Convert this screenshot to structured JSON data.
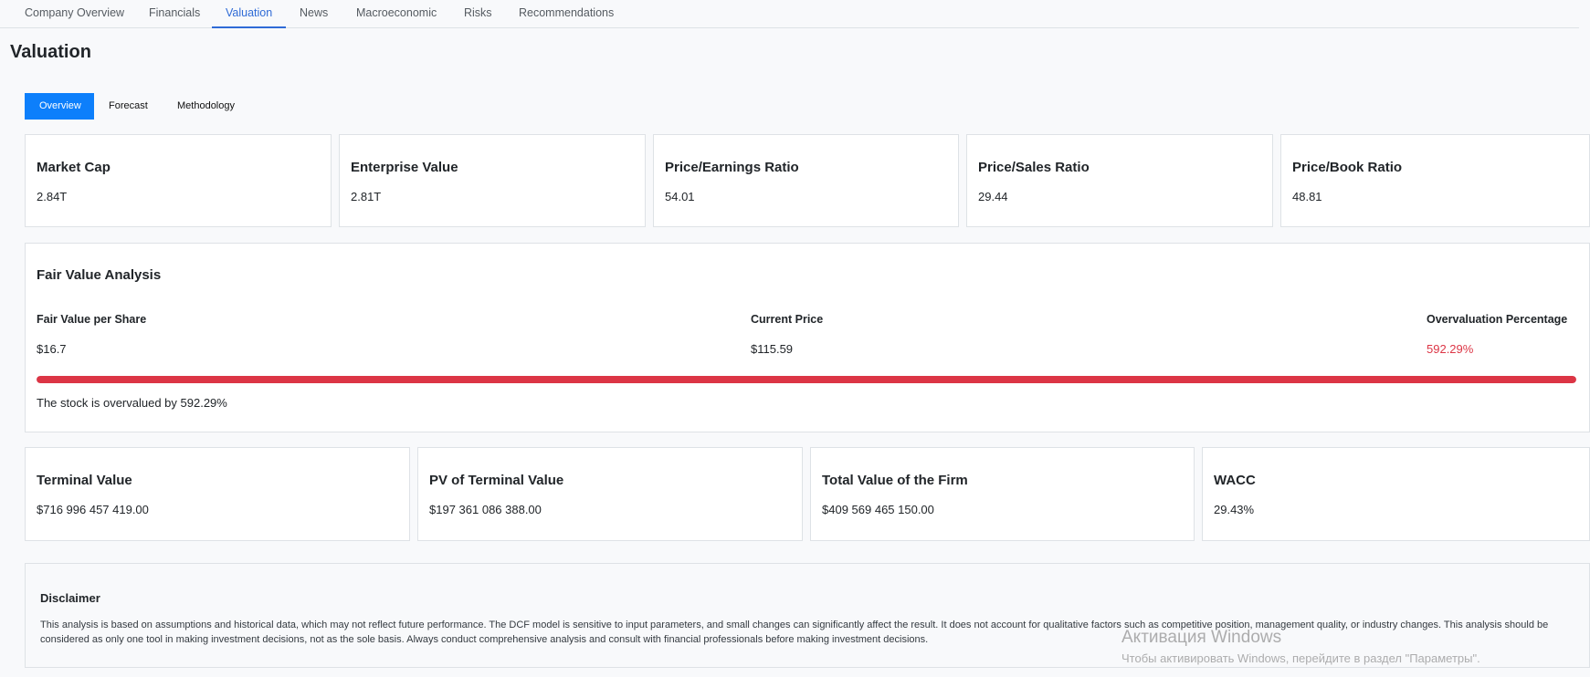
{
  "nav": {
    "tabs": [
      {
        "label": "Company Overview"
      },
      {
        "label": "Financials"
      },
      {
        "label": "Valuation"
      },
      {
        "label": "News"
      },
      {
        "label": "Macroeconomic"
      },
      {
        "label": "Risks"
      },
      {
        "label": "Recommendations"
      }
    ],
    "active_index": 2
  },
  "page": {
    "title": "Valuation"
  },
  "subtabs": [
    {
      "label": "Overview"
    },
    {
      "label": "Forecast"
    },
    {
      "label": "Methodology"
    }
  ],
  "metrics": [
    {
      "title": "Market Cap",
      "value": "2.84T"
    },
    {
      "title": "Enterprise Value",
      "value": "2.81T"
    },
    {
      "title": "Price/Earnings Ratio",
      "value": "54.01"
    },
    {
      "title": "Price/Sales Ratio",
      "value": "29.44"
    },
    {
      "title": "Price/Book Ratio",
      "value": "48.81"
    }
  ],
  "fair_value": {
    "title": "Fair Value Analysis",
    "fair_value_label": "Fair Value per Share",
    "fair_value": "$16.7",
    "current_price_label": "Current Price",
    "current_price": "$115.59",
    "overvaluation_label": "Overvaluation Percentage",
    "overvaluation": "592.29%",
    "bar_fill_percent": 100,
    "note": "The stock is overvalued by 592.29%"
  },
  "dcf": [
    {
      "title": "Terminal Value",
      "value": "$716 996 457 419.00"
    },
    {
      "title": "PV of Terminal Value",
      "value": "$197 361 086 388.00"
    },
    {
      "title": "Total Value of the Firm",
      "value": "$409 569 465 150.00"
    },
    {
      "title": "WACC",
      "value": "29.43%"
    }
  ],
  "disclaimer": {
    "title": "Disclaimer",
    "text": "This analysis is based on assumptions and historical data, which may not reflect future performance. The DCF model is sensitive to input parameters, and small changes can significantly affect the result. It does not account for qualitative factors such as competitive position, management quality, or industry changes. This analysis should be considered as only one tool in making investment decisions, not as the sole basis. Always conduct comprehensive analysis and consult with financial professionals before making investment decisions."
  },
  "watermark": {
    "line1": "Активация Windows",
    "line2": "Чтобы активировать Windows, перейдите в раздел \"Параметры\"."
  },
  "colors": {
    "accent": "#0d7ffb",
    "nav_active": "#2f6bd6",
    "danger": "#dc3545"
  }
}
